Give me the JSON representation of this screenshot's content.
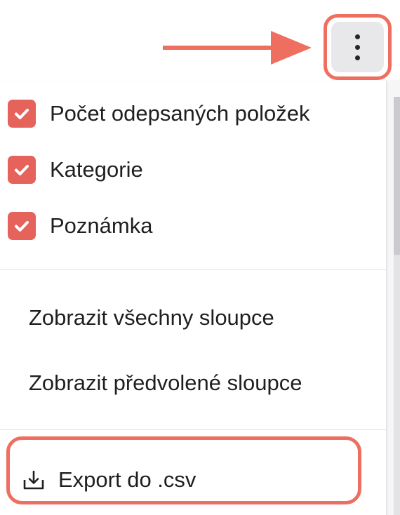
{
  "colors": {
    "accent": "#e5635b",
    "annotation": "#ee6f5f",
    "button_bg": "#e8e8ea"
  },
  "toolbar": {
    "more_button_icon": "vertical-dots-icon"
  },
  "menu": {
    "column_options": [
      {
        "label": "Počet odepsaných položek",
        "checked": true
      },
      {
        "label": "Kategorie",
        "checked": true
      },
      {
        "label": "Poznámka",
        "checked": true
      }
    ],
    "actions": {
      "show_all": "Zobrazit všechny sloupce",
      "show_default": "Zobrazit předvolené sloupce"
    },
    "export": {
      "icon": "download-icon",
      "label": "Export do .csv"
    }
  }
}
